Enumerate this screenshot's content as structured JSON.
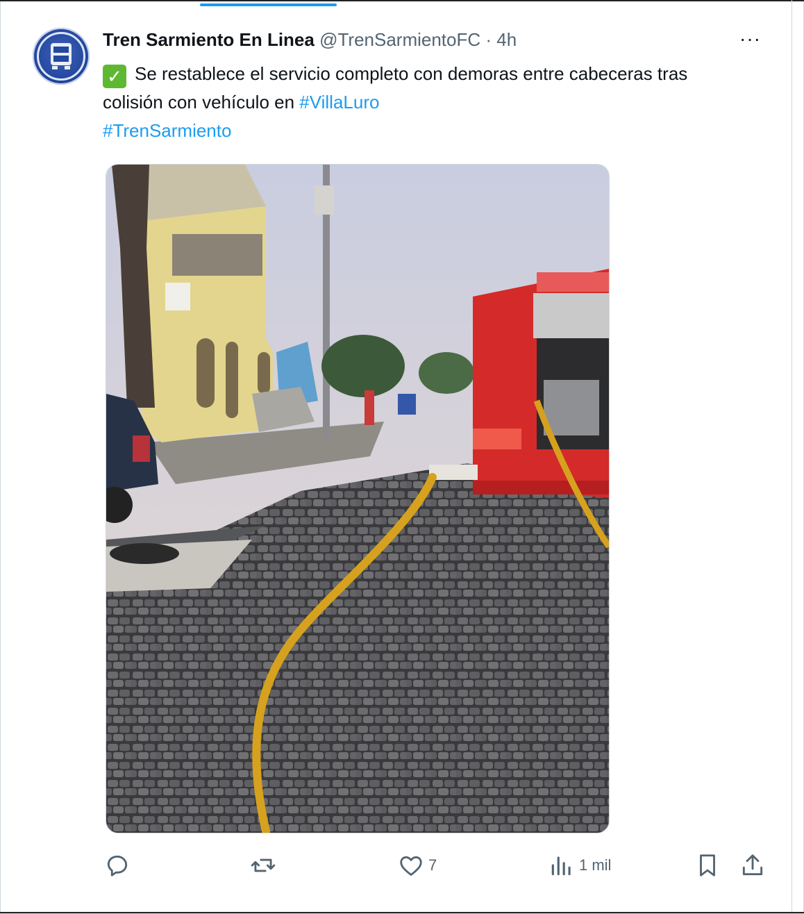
{
  "tweet": {
    "author_name": "Tren Sarmiento En Linea",
    "handle": "@TrenSarmientoFC",
    "separator": "·",
    "time": "4h",
    "more_label": "···",
    "check_glyph": "✓",
    "text_main": "Se restablece el servicio completo con demoras entre cabeceras tras colisión con vehículo en ",
    "hashtag_1": "#VillaLuro",
    "hashtag_2": "#TrenSarmiento"
  },
  "actions": {
    "reply": {
      "icon": "reply-icon",
      "count": ""
    },
    "repost": {
      "icon": "repost-icon",
      "count": ""
    },
    "like": {
      "icon": "heart-icon",
      "count": "7"
    },
    "views": {
      "icon": "views-icon",
      "count": "1 mil"
    },
    "bookmark": {
      "icon": "bookmark-icon"
    },
    "share": {
      "icon": "share-icon"
    }
  },
  "colors": {
    "accent": "#1d9bf0",
    "text": "#0f1419",
    "muted": "#536471",
    "check": "#5fb831"
  }
}
